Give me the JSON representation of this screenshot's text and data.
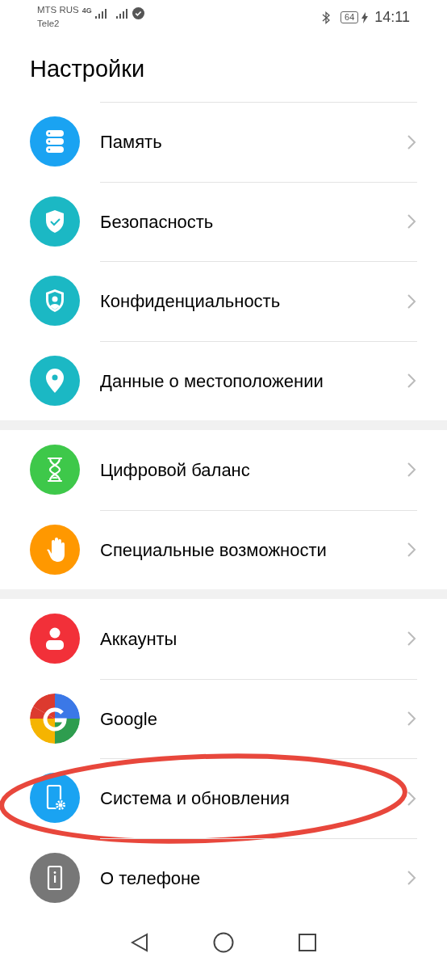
{
  "status_bar": {
    "carriers": [
      "MTS RUS",
      "Tele2"
    ],
    "network": "4G",
    "battery": "64",
    "time": "14:11"
  },
  "title": "Настройки",
  "groups": [
    {
      "items": [
        {
          "label": "Память",
          "kind": "storage",
          "highlighted": false
        },
        {
          "label": "Безопасность",
          "kind": "security",
          "highlighted": false
        },
        {
          "label": "Конфиденциальность",
          "kind": "privacy",
          "highlighted": false
        },
        {
          "label": "Данные о местоположении",
          "kind": "location",
          "highlighted": false
        }
      ]
    },
    {
      "items": [
        {
          "label": "Цифровой баланс",
          "kind": "wellbeing",
          "highlighted": false
        },
        {
          "label": "Специальные возможности",
          "kind": "accessibility",
          "highlighted": false
        }
      ]
    },
    {
      "items": [
        {
          "label": "Аккаунты",
          "kind": "accounts",
          "highlighted": false
        },
        {
          "label": "Google",
          "kind": "google",
          "highlighted": false
        },
        {
          "label": "Система и обновления",
          "kind": "system",
          "highlighted": true
        },
        {
          "label": "О телефоне",
          "kind": "about",
          "highlighted": false
        }
      ]
    }
  ]
}
